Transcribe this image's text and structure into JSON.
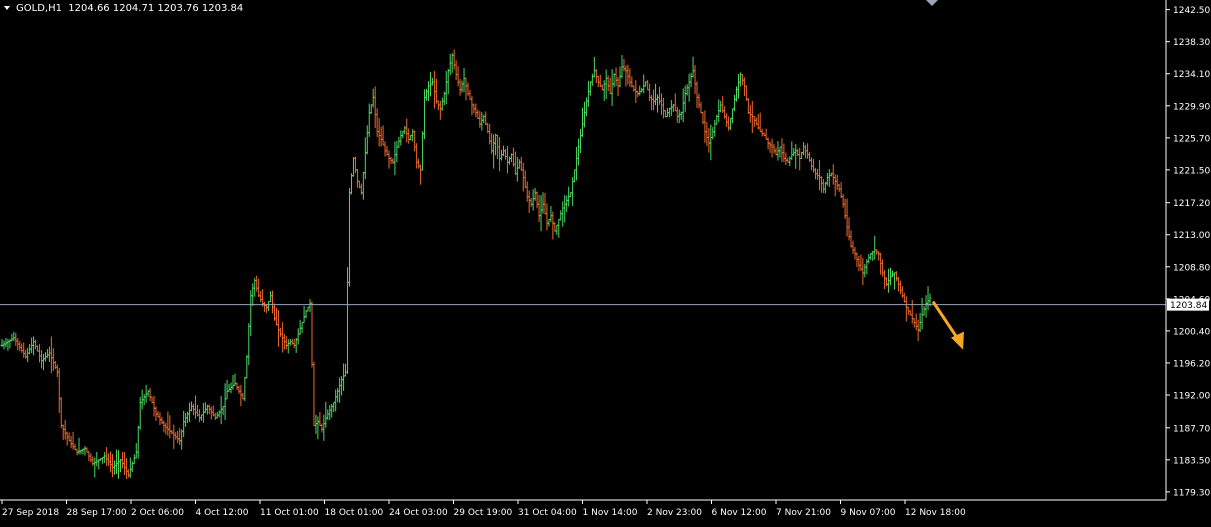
{
  "header": {
    "symbol_line": "GOLD,H1  1204.66 1204.71 1203.76 1203.84"
  },
  "chart_data": {
    "type": "ohlc",
    "symbol": "GOLD",
    "timeframe": "H1",
    "ohlc_readout": {
      "open": 1204.66,
      "high": 1204.71,
      "low": 1203.76,
      "close": 1203.84
    },
    "current_price": 1203.84,
    "current_price_label": "1203.84",
    "ylim": [
      1178.5,
      1243.5
    ],
    "y_ticks": [
      "1242.50",
      "1238.30",
      "1234.10",
      "1229.90",
      "1225.70",
      "1221.50",
      "1217.20",
      "1213.00",
      "1208.80",
      "1204.60",
      "1200.40",
      "1196.20",
      "1192.00",
      "1187.70",
      "1183.50",
      "1179.30"
    ],
    "x_ticks": [
      "27 Sep 2018",
      "28 Sep 17:00",
      "2 Oct 06:00",
      "4 Oct 12:00",
      "11 Oct 01:00",
      "18 Oct 01:00",
      "24 Oct 03:00",
      "29 Oct 19:00",
      "31 Oct 04:00",
      "1 Nov 14:00",
      "2 Nov 23:00",
      "6 Nov 12:00",
      "7 Nov 21:00",
      "9 Nov 07:00",
      "12 Nov 18:00"
    ],
    "price_path": [
      [
        0,
        1198.5
      ],
      [
        3,
        1199.5
      ],
      [
        6,
        1197.0
      ],
      [
        8,
        1199.0
      ],
      [
        10,
        1196.5
      ],
      [
        12,
        1197.5
      ],
      [
        14,
        1195.0
      ],
      [
        15,
        1188.0
      ],
      [
        17,
        1186.0
      ],
      [
        19,
        1184.5
      ],
      [
        21,
        1185.0
      ],
      [
        23,
        1183.0
      ],
      [
        26,
        1184.0
      ],
      [
        28,
        1182.5
      ],
      [
        30,
        1183.5
      ],
      [
        32,
        1181.5
      ],
      [
        34,
        1184.5
      ],
      [
        35,
        1191.0
      ],
      [
        37,
        1192.5
      ],
      [
        39,
        1189.5
      ],
      [
        41,
        1188.0
      ],
      [
        43,
        1187.0
      ],
      [
        45,
        1186.0
      ],
      [
        46,
        1188.5
      ],
      [
        48,
        1190.5
      ],
      [
        50,
        1189.0
      ],
      [
        52,
        1190.5
      ],
      [
        54,
        1189.0
      ],
      [
        56,
        1190.5
      ],
      [
        57,
        1192.5
      ],
      [
        59,
        1193.5
      ],
      [
        61,
        1191.5
      ],
      [
        62,
        1197.0
      ],
      [
        63,
        1205.0
      ],
      [
        64,
        1207.0
      ],
      [
        65,
        1205.0
      ],
      [
        66,
        1204.0
      ],
      [
        67,
        1203.5
      ],
      [
        68,
        1205.0
      ],
      [
        69,
        1202.0
      ],
      [
        70,
        1200.5
      ],
      [
        71,
        1199.5
      ],
      [
        72,
        1198.5
      ],
      [
        73,
        1199.0
      ],
      [
        74,
        1198.5
      ],
      [
        75,
        1200.0
      ],
      [
        76,
        1201.5
      ],
      [
        77,
        1203.0
      ],
      [
        78,
        1204.0
      ],
      [
        79,
        1188.0
      ],
      [
        80,
        1188.5
      ],
      [
        81,
        1187.5
      ],
      [
        82,
        1189.0
      ],
      [
        83,
        1190.0
      ],
      [
        84,
        1191.0
      ],
      [
        85,
        1192.5
      ],
      [
        86,
        1194.0
      ],
      [
        87,
        1195.0
      ],
      [
        88,
        1218.5
      ],
      [
        89,
        1223.0
      ],
      [
        90,
        1220.0
      ],
      [
        91,
        1218.5
      ],
      [
        93,
        1229.0
      ],
      [
        94,
        1231.0
      ],
      [
        95,
        1226.5
      ],
      [
        96,
        1225.5
      ],
      [
        97,
        1224.0
      ],
      [
        98,
        1223.0
      ],
      [
        99,
        1222.5
      ],
      [
        100,
        1224.5
      ],
      [
        101,
        1226.0
      ],
      [
        102,
        1227.0
      ],
      [
        103,
        1225.5
      ],
      [
        104,
        1226.5
      ],
      [
        105,
        1222.5
      ],
      [
        106,
        1221.5
      ],
      [
        107,
        1231.0
      ],
      [
        108,
        1232.5
      ],
      [
        109,
        1233.0
      ],
      [
        110,
        1230.5
      ],
      [
        111,
        1229.5
      ],
      [
        112,
        1231.5
      ],
      [
        113,
        1234.5
      ],
      [
        114,
        1236.5
      ],
      [
        115,
        1234.0
      ],
      [
        116,
        1232.0
      ],
      [
        117,
        1233.5
      ],
      [
        118,
        1231.5
      ],
      [
        119,
        1230.0
      ],
      [
        120,
        1229.0
      ],
      [
        121,
        1227.5
      ],
      [
        122,
        1228.5
      ],
      [
        123,
        1226.5
      ],
      [
        124,
        1224.0
      ],
      [
        125,
        1226.0
      ],
      [
        126,
        1223.0
      ],
      [
        127,
        1224.0
      ],
      [
        128,
        1222.5
      ],
      [
        129,
        1223.5
      ],
      [
        130,
        1221.0
      ],
      [
        131,
        1222.5
      ],
      [
        132,
        1220.5
      ],
      [
        133,
        1218.0
      ],
      [
        134,
        1217.0
      ],
      [
        135,
        1218.5
      ],
      [
        136,
        1215.5
      ],
      [
        137,
        1217.0
      ],
      [
        138,
        1214.5
      ],
      [
        139,
        1215.5
      ],
      [
        140,
        1213.5
      ],
      [
        141,
        1215.0
      ],
      [
        142,
        1216.5
      ],
      [
        143,
        1217.5
      ],
      [
        144,
        1218.5
      ],
      [
        145,
        1221.5
      ],
      [
        146,
        1224.5
      ],
      [
        147,
        1227.5
      ],
      [
        148,
        1230.5
      ],
      [
        149,
        1233.0
      ],
      [
        150,
        1234.5
      ],
      [
        151,
        1233.0
      ],
      [
        152,
        1232.0
      ],
      [
        153,
        1233.5
      ],
      [
        154,
        1231.5
      ],
      [
        155,
        1234.0
      ],
      [
        156,
        1232.5
      ],
      [
        157,
        1235.0
      ],
      [
        158,
        1234.5
      ],
      [
        159,
        1233.0
      ],
      [
        160,
        1232.0
      ],
      [
        161,
        1231.5
      ],
      [
        162,
        1232.0
      ],
      [
        163,
        1233.0
      ],
      [
        164,
        1231.0
      ],
      [
        165,
        1230.5
      ],
      [
        166,
        1231.0
      ],
      [
        167,
        1230.0
      ],
      [
        168,
        1228.5
      ],
      [
        169,
        1229.5
      ],
      [
        170,
        1230.0
      ],
      [
        171,
        1228.5
      ],
      [
        172,
        1229.0
      ],
      [
        173,
        1231.5
      ],
      [
        174,
        1233.0
      ],
      [
        175,
        1234.5
      ],
      [
        176,
        1231.0
      ],
      [
        177,
        1229.0
      ],
      [
        178,
        1226.5
      ],
      [
        179,
        1225.0
      ],
      [
        180,
        1226.5
      ],
      [
        181,
        1228.5
      ],
      [
        182,
        1230.0
      ],
      [
        183,
        1228.5
      ],
      [
        184,
        1227.0
      ],
      [
        185,
        1229.5
      ],
      [
        186,
        1232.0
      ],
      [
        187,
        1234.0
      ],
      [
        188,
        1232.5
      ],
      [
        189,
        1229.0
      ],
      [
        190,
        1228.5
      ],
      [
        191,
        1227.5
      ],
      [
        192,
        1226.5
      ],
      [
        193,
        1226.0
      ],
      [
        194,
        1225.0
      ],
      [
        195,
        1224.5
      ],
      [
        196,
        1223.5
      ],
      [
        197,
        1224.5
      ],
      [
        198,
        1223.0
      ],
      [
        199,
        1222.5
      ],
      [
        200,
        1223.5
      ],
      [
        201,
        1224.0
      ],
      [
        202,
        1223.0
      ],
      [
        203,
        1224.5
      ],
      [
        204,
        1223.5
      ],
      [
        205,
        1222.0
      ],
      [
        206,
        1221.0
      ],
      [
        207,
        1220.5
      ],
      [
        208,
        1219.0
      ],
      [
        209,
        1220.5
      ],
      [
        210,
        1221.0
      ],
      [
        211,
        1220.0
      ],
      [
        212,
        1219.0
      ],
      [
        213,
        1217.0
      ],
      [
        214,
        1214.0
      ],
      [
        215,
        1211.5
      ],
      [
        216,
        1210.5
      ],
      [
        217,
        1209.0
      ],
      [
        218,
        1208.0
      ],
      [
        219,
        1209.5
      ],
      [
        220,
        1210.5
      ],
      [
        221,
        1211.0
      ],
      [
        222,
        1210.5
      ],
      [
        223,
        1208.0
      ],
      [
        224,
        1206.5
      ],
      [
        225,
        1207.5
      ],
      [
        226,
        1208.0
      ],
      [
        227,
        1206.5
      ],
      [
        228,
        1205.0
      ],
      [
        229,
        1203.5
      ],
      [
        230,
        1202.5
      ],
      [
        231,
        1201.5
      ],
      [
        232,
        1200.5
      ],
      [
        233,
        1202.5
      ],
      [
        234,
        1204.0
      ],
      [
        235,
        1204.7
      ]
    ],
    "arrow": {
      "direction": "down-right",
      "color": "#F5A623"
    }
  },
  "colors": {
    "background": "#000000",
    "axis": "#FFFFFF",
    "text": "#FFFFFF",
    "bull": "#4CD964",
    "bear": "#F06A2E",
    "price_line": "#9AA6B8",
    "arrow": "#F5A623"
  }
}
